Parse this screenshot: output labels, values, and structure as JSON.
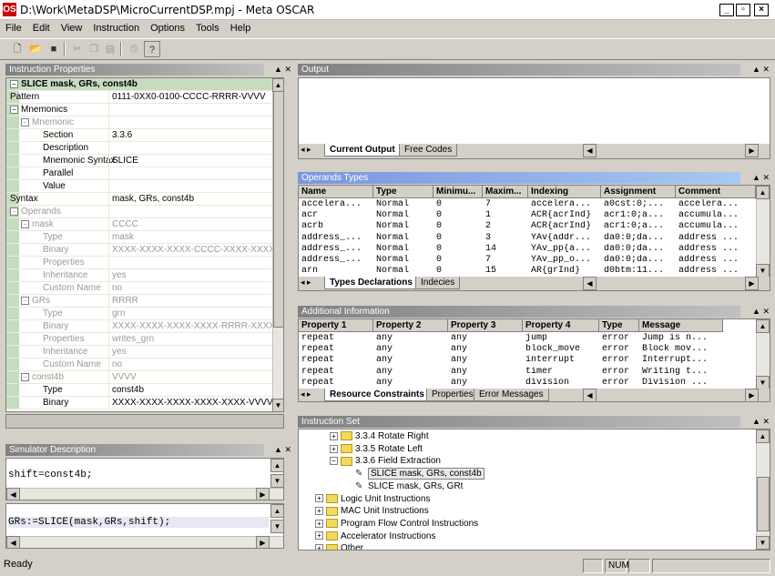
{
  "window": {
    "title": "D:\\Work\\MetaDSP\\MicroCurrentDSP.mpj - Meta OSCAR",
    "app_icon": "OS"
  },
  "menu": [
    "File",
    "Edit",
    "View",
    "Instruction",
    "Options",
    "Tools",
    "Help"
  ],
  "toolbar": {
    "icons": [
      "new-file-icon",
      "open-folder-icon",
      "save-icon",
      "cut-icon",
      "copy-icon",
      "paste-icon",
      "print-icon",
      "help-icon"
    ]
  },
  "instruction_properties": {
    "title": "Instruction Properties",
    "rows": [
      {
        "k": "SLICE  mask, GRs, const4b",
        "v": "",
        "lvl": 0,
        "pm": "−",
        "bold": true,
        "dim": false,
        "sel": true
      },
      {
        "k": "Pattern",
        "v": "0111-0XX0-0100-CCCC-RRRR-VVVV",
        "lvl": 0,
        "pm": "",
        "dim": false
      },
      {
        "k": "Mnemonics",
        "v": "",
        "lvl": 0,
        "pm": "−",
        "dim": false
      },
      {
        "k": "Mnemonic",
        "v": "",
        "lvl": 1,
        "pm": "−",
        "dim": true
      },
      {
        "k": "Section",
        "v": "3.3.6",
        "lvl": 2,
        "pm": "",
        "dim": false
      },
      {
        "k": "Description",
        "v": "",
        "lvl": 2,
        "pm": "",
        "dim": false
      },
      {
        "k": "Mnemonic Syntax",
        "v": "SLICE",
        "lvl": 2,
        "pm": "",
        "dim": false
      },
      {
        "k": "Parallel",
        "v": "",
        "lvl": 2,
        "pm": "",
        "dim": false
      },
      {
        "k": "Value",
        "v": "",
        "lvl": 2,
        "pm": "",
        "dim": false
      },
      {
        "k": "Syntax",
        "v": "mask, GRs, const4b",
        "lvl": 0,
        "pm": "",
        "dim": false
      },
      {
        "k": "Operands",
        "v": "",
        "lvl": 0,
        "pm": "−",
        "dim": true
      },
      {
        "k": "mask",
        "v": "CCCC",
        "lvl": 1,
        "pm": "−",
        "dim": true
      },
      {
        "k": "Type",
        "v": "mask",
        "lvl": 2,
        "pm": "",
        "dim": true
      },
      {
        "k": "Binary",
        "v": "XXXX-XXXX-XXXX-CCCC-XXXX-XXXX",
        "lvl": 2,
        "pm": "",
        "dim": true
      },
      {
        "k": "Properties",
        "v": "",
        "lvl": 2,
        "pm": "",
        "dim": true
      },
      {
        "k": "Inheritance",
        "v": "yes",
        "lvl": 2,
        "pm": "",
        "dim": true
      },
      {
        "k": "Custom Name",
        "v": "no",
        "lvl": 2,
        "pm": "",
        "dim": true
      },
      {
        "k": "GRs",
        "v": "RRRR",
        "lvl": 1,
        "pm": "−",
        "dim": true
      },
      {
        "k": "Type",
        "v": "grn",
        "lvl": 2,
        "pm": "",
        "dim": true
      },
      {
        "k": "Binary",
        "v": "XXXX-XXXX-XXXX-XXXX-RRRR-XXXX",
        "lvl": 2,
        "pm": "",
        "dim": true
      },
      {
        "k": "Properties",
        "v": "writes_grn",
        "lvl": 2,
        "pm": "",
        "dim": true
      },
      {
        "k": "Inheritance",
        "v": "yes",
        "lvl": 2,
        "pm": "",
        "dim": true
      },
      {
        "k": "Custom Name",
        "v": "no",
        "lvl": 2,
        "pm": "",
        "dim": true
      },
      {
        "k": "const4b",
        "v": "VVVV",
        "lvl": 1,
        "pm": "−",
        "dim": true
      },
      {
        "k": "Type",
        "v": "const4b",
        "lvl": 2,
        "pm": "",
        "dim": false
      },
      {
        "k": "Binary",
        "v": "XXXX-XXXX-XXXX-XXXX-XXXX-VVVV",
        "lvl": 2,
        "pm": "",
        "dim": false
      }
    ]
  },
  "simulator": {
    "title": "Simulator Description",
    "line1": "shift=const4b;",
    "line2": "GRs:=SLICE(mask,GRs,shift);"
  },
  "output": {
    "title": "Output",
    "tabs": [
      "Current Output",
      "Free Codes"
    ]
  },
  "operands": {
    "title": "Operands Types",
    "headers": [
      "Name",
      "Type",
      "Minimu...",
      "Maxim...",
      "Indexing",
      "Assignment",
      "Comment"
    ],
    "rows": [
      [
        "accelera...",
        "Normal",
        "0",
        "7",
        "accelera...",
        "a0cst:0;...",
        "accelera..."
      ],
      [
        "acr",
        "Normal",
        "0",
        "1",
        "ACR{acrInd}",
        "acr1:0;a...",
        "accumula..."
      ],
      [
        "acrb",
        "Normal",
        "0",
        "2",
        "ACR{acrInd}",
        "acr1:0;a...",
        "accumula..."
      ],
      [
        "address_...",
        "Normal",
        "0",
        "3",
        "YAv{addr...",
        "da0:0;da...",
        "address ..."
      ],
      [
        "address_...",
        "Normal",
        "0",
        "14",
        "YAv_pp{a...",
        "da0:0;da...",
        "address ..."
      ],
      [
        "address_...",
        "Normal",
        "0",
        "7",
        "YAv_pp_o...",
        "da0:0;da...",
        "address ..."
      ],
      [
        "arn",
        "Normal",
        "0",
        "15",
        "AR{grInd}",
        "d0btm:11...",
        "address ..."
      ]
    ],
    "tabs": [
      "Types Declarations",
      "Indecies"
    ]
  },
  "additional": {
    "title": "Additional Information",
    "headers": [
      "Property 1",
      "Property 2",
      "Property 3",
      "Property 4",
      "Type",
      "Message"
    ],
    "rows": [
      [
        "repeat",
        "any",
        "any",
        "jump",
        "error",
        "Jump is n..."
      ],
      [
        "repeat",
        "any",
        "any",
        "block_move",
        "error",
        "Block mov..."
      ],
      [
        "repeat",
        "any",
        "any",
        "interrupt",
        "error",
        "Interrupt..."
      ],
      [
        "repeat",
        "any",
        "any",
        "timer",
        "error",
        "Writing t..."
      ],
      [
        "repeat",
        "any",
        "any",
        "division",
        "error",
        "Division ..."
      ]
    ],
    "tabs": [
      "Resource Constraints",
      "Properties",
      "Error Messages"
    ]
  },
  "instruction_set": {
    "title": "Instruction Set",
    "items": [
      {
        "label": "3.3.4 Rotate Right",
        "indent": 1,
        "icon": "folder",
        "pm": "+"
      },
      {
        "label": "3.3.5 Rotate Left",
        "indent": 1,
        "icon": "folder",
        "pm": "+"
      },
      {
        "label": "3.3.6 Field Extraction",
        "indent": 1,
        "icon": "folder",
        "pm": "−"
      },
      {
        "label": "SLICE  mask, GRs, const4b",
        "indent": 2,
        "icon": "instr",
        "pm": "",
        "sel": true
      },
      {
        "label": "SLICE  mask, GRs, GRt",
        "indent": 2,
        "icon": "instr",
        "pm": ""
      },
      {
        "label": "Logic Unit Instructions",
        "indent": 0,
        "icon": "folder",
        "pm": "+"
      },
      {
        "label": "MAC Unit Instructions",
        "indent": 0,
        "icon": "folder",
        "pm": "+"
      },
      {
        "label": "Program Flow Control Instructions",
        "indent": 0,
        "icon": "folder",
        "pm": "+"
      },
      {
        "label": "Accelerator Instructions",
        "indent": 0,
        "icon": "folder",
        "pm": "+"
      },
      {
        "label": "Other",
        "indent": 0,
        "icon": "folder",
        "pm": "+"
      }
    ]
  },
  "status": {
    "text": "Ready",
    "num": "NUM"
  },
  "colors": {
    "title_grad_start": "#7a96df",
    "title_grad_end": "#a6caf0",
    "gutter": "#c5dcc0",
    "folder": "#f2d85c"
  }
}
